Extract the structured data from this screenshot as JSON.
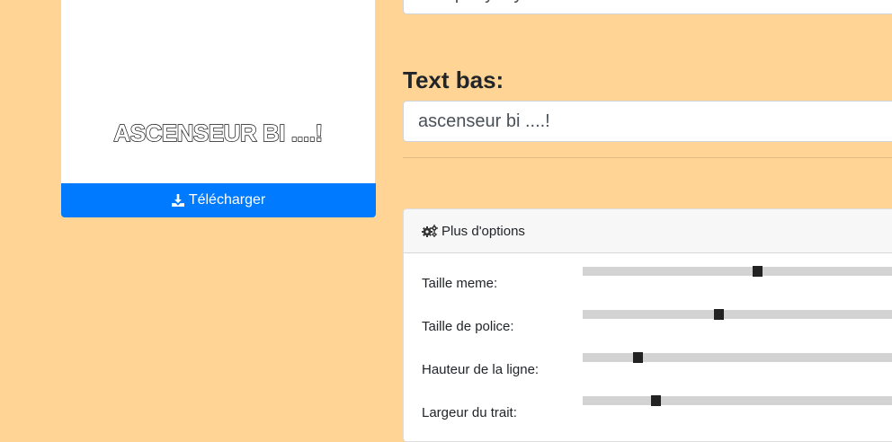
{
  "meme": {
    "bottom_text": "ASCENSEUR BI ....!"
  },
  "download_button": {
    "label": "Télécharger",
    "icon": "download-icon"
  },
  "form": {
    "top_text_value": "Woop-lay-lay-un...",
    "bottom_label": "Text bas:",
    "bottom_text_value": "ascenseur bi ....!"
  },
  "options": {
    "header_label": "Plus d'options",
    "header_icon": "cogs-icon",
    "sliders": [
      {
        "label": "Taille meme:",
        "value": 0.54
      },
      {
        "label": "Taille de police:",
        "value": 0.42
      },
      {
        "label": "Hauteur de la ligne:",
        "value": 0.17
      },
      {
        "label": "Largeur du trait:",
        "value": 0.225
      }
    ]
  },
  "colors": {
    "page_background": "#ffd494",
    "button_primary": "#007bff",
    "slider_track": "#d3d3d3",
    "slider_thumb": "#222222"
  }
}
